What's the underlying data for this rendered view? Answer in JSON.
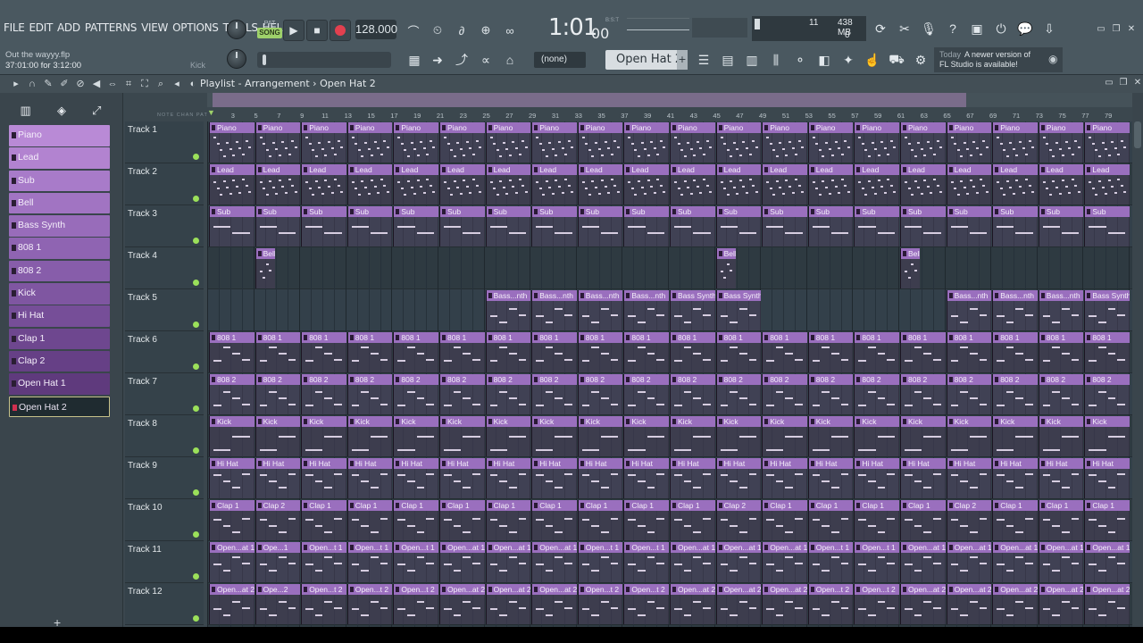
{
  "menu": [
    "FILE",
    "EDIT",
    "ADD",
    "PATTERNS",
    "VIEW",
    "OPTIONS",
    "TOOLS",
    "HELP"
  ],
  "file": {
    "name": "Out the wayyy.flp",
    "position": "37:01:00 for 3:12:00",
    "hint": "Kick"
  },
  "transport": {
    "pat_label": "PAT",
    "song_label": "SONG",
    "tempo": "128.000",
    "time_main": "1:01",
    "time_small": "00",
    "time_format": "B:S:T"
  },
  "monitor": {
    "cpu": "11",
    "memory": "438 MB",
    "polyphony": "0"
  },
  "snap": "(none)",
  "current_pattern": "Open Hat 2",
  "news": {
    "today": "Today",
    "line1": "A newer version of",
    "line2": "FL Studio is available!"
  },
  "playlist": {
    "title": "Playlist - Arrangement",
    "separator": "›",
    "current": "Open Hat 2",
    "ruler_labels": "NOTE  CHAN  PAT",
    "bars": [
      "3",
      "5",
      "7",
      "9",
      "11",
      "13",
      "15",
      "17",
      "19",
      "21",
      "23",
      "25",
      "27",
      "29",
      "31",
      "33",
      "35",
      "37",
      "39",
      "41",
      "43",
      "45",
      "47",
      "49",
      "51",
      "53",
      "55",
      "57",
      "59",
      "61",
      "63",
      "65",
      "67",
      "69",
      "71",
      "73",
      "75",
      "77",
      "79"
    ]
  },
  "patterns": [
    {
      "name": "Piano",
      "color": "#b98ad6"
    },
    {
      "name": "Lead",
      "color": "#b283d0"
    },
    {
      "name": "Sub",
      "color": "#a87bc9"
    },
    {
      "name": "Bell",
      "color": "#a174c2"
    },
    {
      "name": "Bass Synth",
      "color": "#986cba"
    },
    {
      "name": "808 1",
      "color": "#8f64b2"
    },
    {
      "name": "808 2",
      "color": "#875daa"
    },
    {
      "name": "Kick",
      "color": "#7f56a1"
    },
    {
      "name": "Hi Hat",
      "color": "#764e98"
    },
    {
      "name": "Clap 1",
      "color": "#6e478f"
    },
    {
      "name": "Clap 2",
      "color": "#664086"
    },
    {
      "name": "Open Hat 1",
      "color": "#5f3a7d"
    },
    {
      "name": "Open Hat 2",
      "color": "#583575",
      "selected": true
    }
  ],
  "tracks": [
    {
      "name": "Track 1",
      "labels": [
        "Piano"
      ]
    },
    {
      "name": "Track 2",
      "labels": [
        "Lead"
      ]
    },
    {
      "name": "Track 3",
      "labels": [
        "Sub"
      ]
    },
    {
      "name": "Track 4",
      "labels": [
        "Bell"
      ]
    },
    {
      "name": "Track 5",
      "labels": [
        "Bass...nth",
        "Bass Synth"
      ]
    },
    {
      "name": "Track 6",
      "labels": [
        "808 1"
      ]
    },
    {
      "name": "Track 7",
      "labels": [
        "808 2"
      ]
    },
    {
      "name": "Track 8",
      "labels": [
        "Kick"
      ]
    },
    {
      "name": "Track 9",
      "labels": [
        "Hi Hat"
      ]
    },
    {
      "name": "Track 10",
      "labels": [
        "Clap 1",
        "Clap 2"
      ]
    },
    {
      "name": "Track 11",
      "labels": [
        "Open...at 1",
        "Ope...1",
        "Open...t 1"
      ]
    },
    {
      "name": "Track 12",
      "labels": [
        "Open...at 2",
        "Ope...2",
        "Open...t 2"
      ]
    }
  ],
  "colors": {
    "clip_header": "#9a6fbe",
    "song_mode": "#9ed16a",
    "record": "#e2404f",
    "track_led": "#9be05a"
  }
}
